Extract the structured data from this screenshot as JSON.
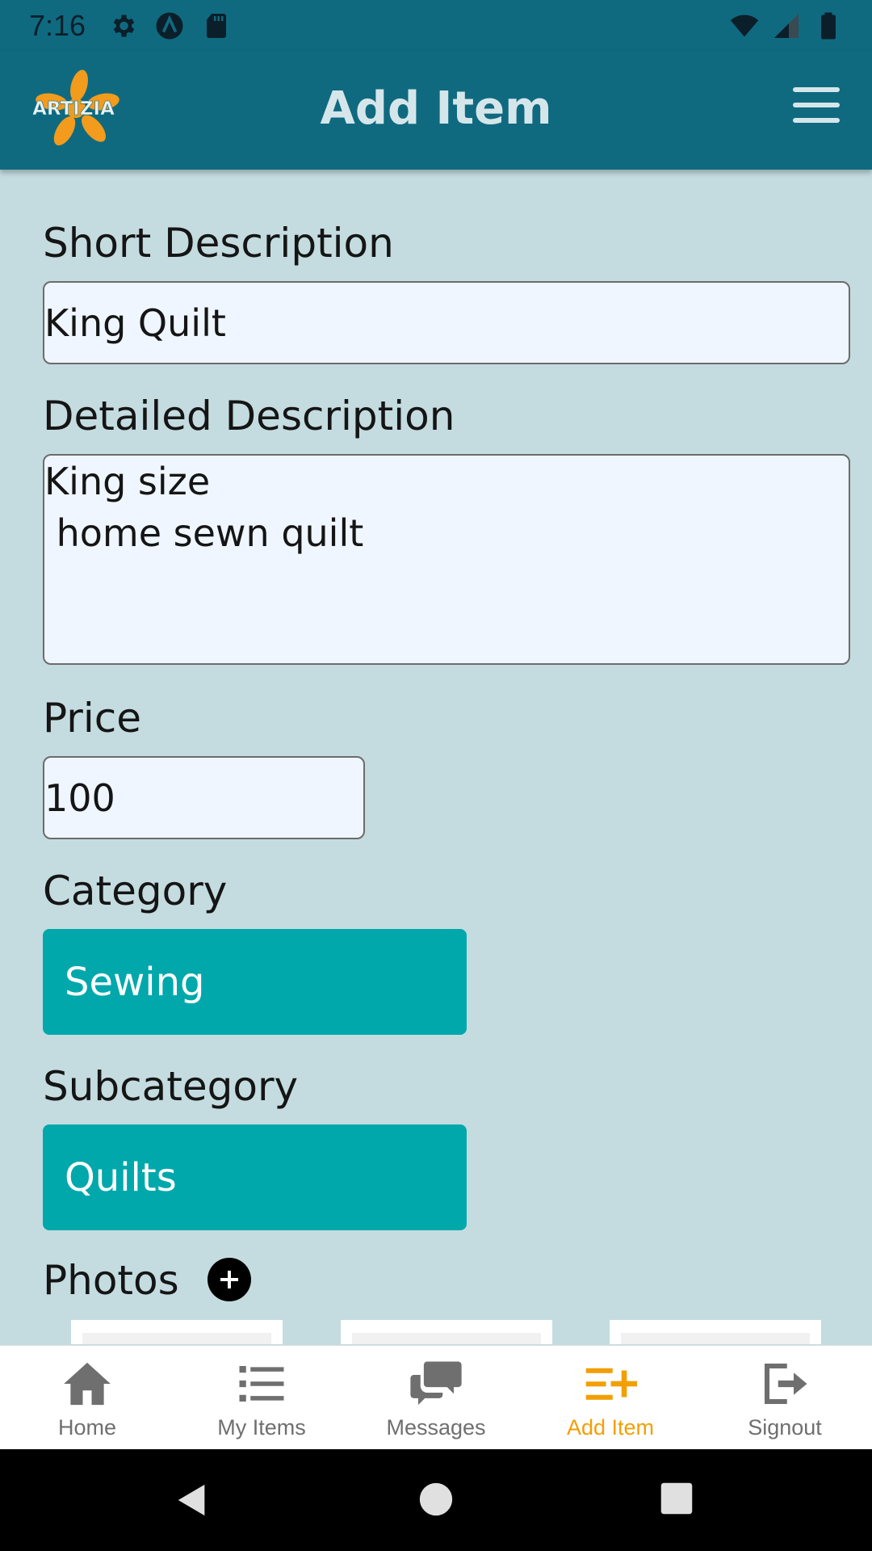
{
  "status_bar": {
    "time": "7:16",
    "left_icons": [
      "gear-icon",
      "a-circle-icon",
      "sd-card-icon"
    ],
    "right_icons": [
      "wifi-icon",
      "signal-icon",
      "battery-icon"
    ]
  },
  "header": {
    "logo_text": "ARTIZIA",
    "title": "Add Item",
    "menu_icon": "hamburger-menu-icon"
  },
  "form": {
    "short_description": {
      "label": "Short Description",
      "value": "King Quilt"
    },
    "detailed_description": {
      "label": "Detailed Description",
      "value": "King size\n home sewn quilt"
    },
    "price": {
      "label": "Price",
      "value": "100"
    },
    "category": {
      "label": "Category",
      "value": "Sewing"
    },
    "subcategory": {
      "label": "Subcategory",
      "value": "Quilts"
    },
    "photos": {
      "label": "Photos",
      "add_icon": "plus-circle-icon"
    }
  },
  "bottom_nav": {
    "items": [
      {
        "label": "Home",
        "icon": "home-icon"
      },
      {
        "label": "My Items",
        "icon": "list-icon"
      },
      {
        "label": "Messages",
        "icon": "chat-bubbles-icon"
      },
      {
        "label": "Add Item",
        "icon": "list-add-icon",
        "active": true
      },
      {
        "label": "Signout",
        "icon": "exit-icon"
      }
    ],
    "active_color": "#f29f05"
  },
  "system_nav": {
    "icons": [
      "back-icon",
      "home-circle-icon",
      "recents-square-icon"
    ]
  },
  "colors": {
    "header": "#0f6a80",
    "background": "#c4dce0",
    "select": "#00a8ab",
    "input_bg": "#eff6ff"
  }
}
